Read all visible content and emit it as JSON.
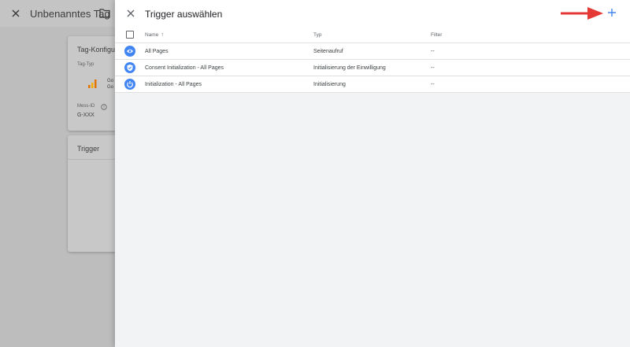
{
  "background": {
    "title": "Unbenanntes Tag",
    "config_card": {
      "title": "Tag-Konfigu",
      "tag_type_label": "Tag-Typ",
      "tag_type_value_1": "Go",
      "tag_type_value_2": "Go",
      "mess_id_label": "Mess-ID",
      "mess_id_value": "G-XXX"
    },
    "trigger_card": {
      "title": "Trigger"
    }
  },
  "panel": {
    "title": "Trigger auswählen",
    "add_icon": "plus-icon",
    "close_icon": "close-icon",
    "table": {
      "headers": {
        "name": "Name",
        "name_sort": "↑",
        "type": "Typ",
        "filter": "Filter"
      },
      "rows": [
        {
          "icon": "eye-icon",
          "name": "All Pages",
          "type": "Seitenaufruf",
          "filter": "--"
        },
        {
          "icon": "shield-icon",
          "name": "Consent Initialization - All Pages",
          "type": "Initialisierung der Einwilligung",
          "filter": "--"
        },
        {
          "icon": "power-icon",
          "name": "Initialization - All Pages",
          "type": "Initialisierung",
          "filter": "--"
        }
      ]
    }
  },
  "colors": {
    "accent": "#4285f4",
    "arrow": "#e53935",
    "panel_bg": "#f1f3f4",
    "overlay_bg": "#bdbdbd"
  }
}
